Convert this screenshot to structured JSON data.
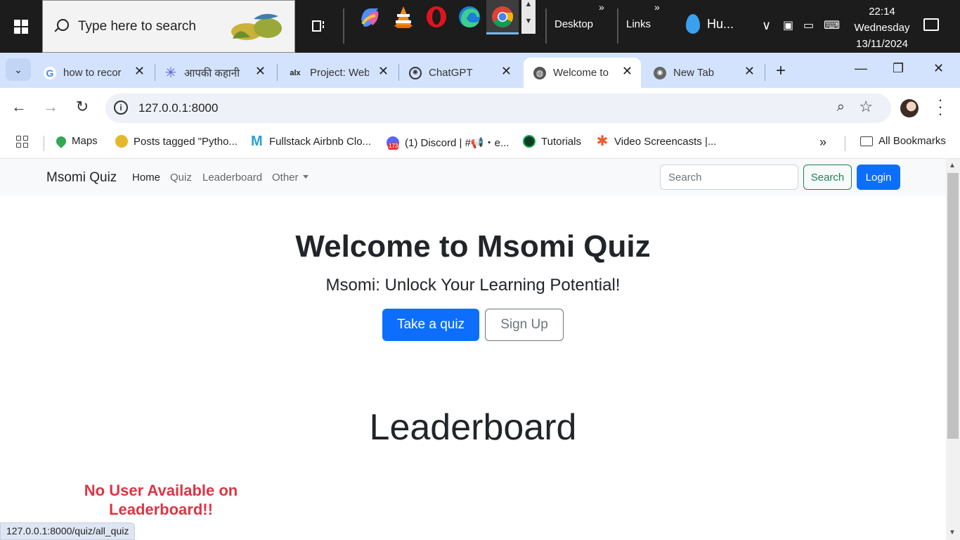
{
  "taskbar": {
    "search_placeholder": "Type here to search",
    "toolbars": {
      "desktop": "Desktop",
      "links": "Links"
    },
    "weather": "Hu...",
    "clock": {
      "time": "22:14",
      "day": "Wednesday",
      "date": "13/11/2024"
    }
  },
  "tabs": [
    {
      "title": "how to recor",
      "icon": "google-icon"
    },
    {
      "title": "आपकी कहानी",
      "icon": "starburst-icon"
    },
    {
      "title": "Project: Web",
      "icon": "alx-icon"
    },
    {
      "title": "ChatGPT",
      "icon": "chatgpt-icon"
    },
    {
      "title": "Welcome to",
      "icon": "globe-icon",
      "active": true
    },
    {
      "title": "New Tab",
      "icon": "chrome-icon"
    }
  ],
  "omnibox": {
    "url": "127.0.0.1:8000"
  },
  "bookmarks": {
    "items": [
      {
        "label": "Maps"
      },
      {
        "label": "Posts tagged \"Pytho..."
      },
      {
        "label": "Fullstack Airbnb Clo..."
      },
      {
        "label": "(1) Discord | #📢・e..."
      },
      {
        "label": "Tutorials"
      },
      {
        "label": "Video Screencasts |..."
      }
    ],
    "badge": "173",
    "all_bookmarks": "All Bookmarks"
  },
  "site": {
    "brand": "Msomi Quiz",
    "nav": {
      "home": "Home",
      "quiz": "Quiz",
      "leaderboard": "Leaderboard",
      "other": "Other"
    },
    "search_placeholder": "Search",
    "search_button": "Search",
    "login_button": "Login",
    "hero_title": "Welcome to Msomi Quiz",
    "hero_subtitle": "Msomi: Unlock Your Learning Potential!",
    "take_quiz_button": "Take a quiz",
    "signup_button": "Sign Up",
    "leaderboard_title": "Leaderboard",
    "no_user_message": "No User Available on Leaderboard!!"
  },
  "status_url": "127.0.0.1:8000/quiz/all_quiz",
  "colors": {
    "primary": "#0d6efd",
    "success": "#198754",
    "danger": "#dc3545",
    "tabstrip": "#d3e3fd"
  }
}
